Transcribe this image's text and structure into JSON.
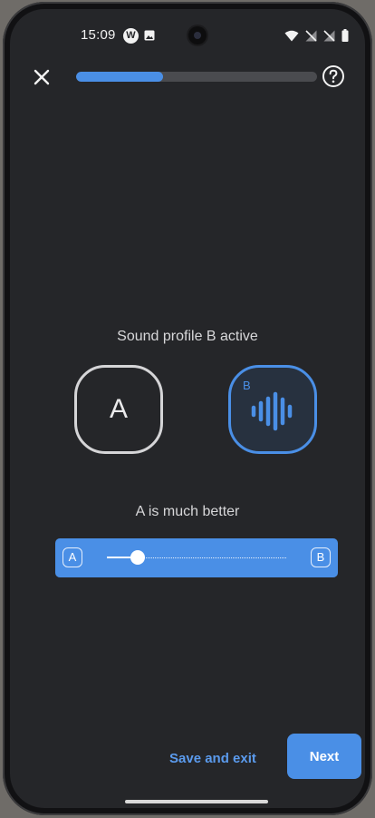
{
  "status_bar": {
    "time": "15:09",
    "app_badge": "W",
    "icons": [
      "wifi-icon",
      "signal-off-icon",
      "signal-off-icon",
      "battery-icon"
    ]
  },
  "header": {
    "close_icon": "close-icon",
    "help_icon": "help-icon",
    "progress_fraction": 0.36
  },
  "main": {
    "profile_status": "Sound profile B active",
    "profile_a": {
      "letter": "A"
    },
    "profile_b": {
      "letter": "B",
      "icon": "sound-wave-icon"
    },
    "rating_text": "A is much better",
    "slider": {
      "left_label": "A",
      "right_label": "B",
      "value_fraction": 0.17
    }
  },
  "footer": {
    "save_exit_label": "Save and exit",
    "next_label": "Next"
  },
  "colors": {
    "accent": "#4a8fe6",
    "background": "#252629"
  }
}
